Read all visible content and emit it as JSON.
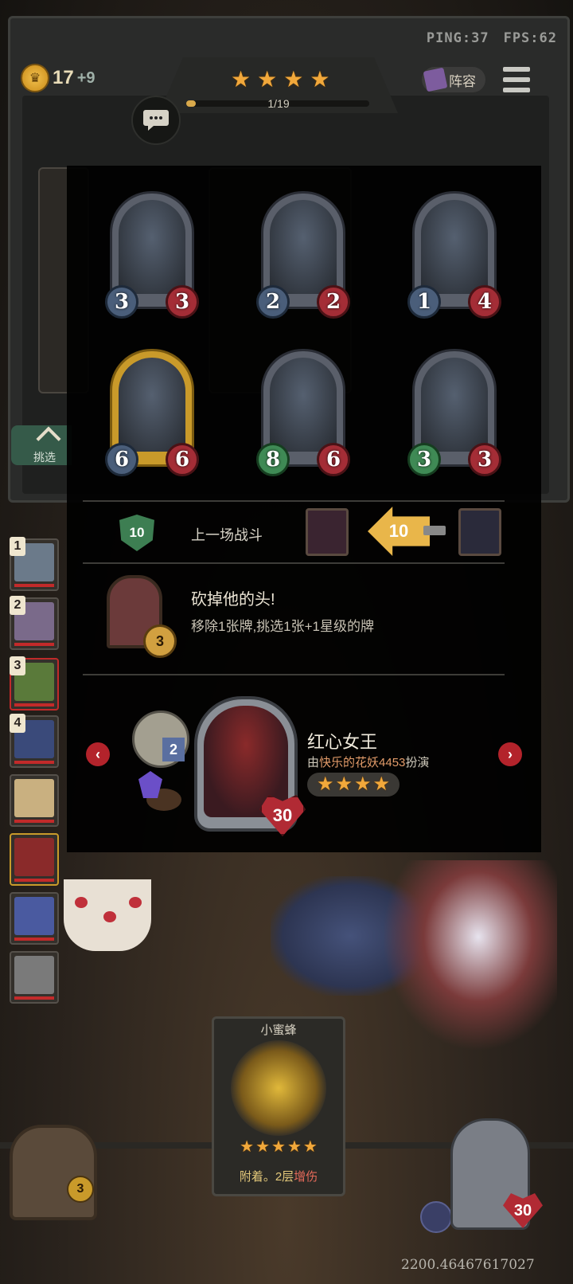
{
  "status": {
    "ping": "PING:37",
    "fps": "FPS:62"
  },
  "gold": {
    "amount": "17",
    "bonus": "+9"
  },
  "tier": {
    "stars": [
      "★",
      "★",
      "★",
      "★"
    ],
    "xp_text": "1/19",
    "xp_fraction": 0.053
  },
  "lineup_button": "阵容",
  "refresh_button": "挑选",
  "shop_cards": [
    {
      "atk": "3",
      "hp": "3",
      "gold": false
    },
    {
      "atk": "2",
      "hp": "2",
      "gold": false
    },
    {
      "atk": "1",
      "hp": "4",
      "gold": false
    },
    {
      "atk": "6",
      "hp": "6",
      "gold": true
    },
    {
      "atk": "8",
      "hp": "6",
      "gold": false,
      "atk_color": "green"
    },
    {
      "atk": "3",
      "hp": "3",
      "gold": false,
      "atk_color": "green"
    }
  ],
  "last_battle": {
    "badge": "10",
    "label": "上一场战斗",
    "damage": "10"
  },
  "event": {
    "title": "砍掉他的头!",
    "description": "移除1张牌,挑选1张+1星级的牌",
    "level": "3"
  },
  "hero": {
    "name": "红心女王",
    "player_prefix": "由",
    "player_name": "快乐的花妖4453",
    "player_suffix": "扮演",
    "stars": [
      "★",
      "★",
      "★",
      "★"
    ],
    "hp": "30",
    "power_count": "2"
  },
  "roster": [
    "1",
    "2",
    "3",
    "4",
    "",
    "",
    "",
    ""
  ],
  "bottom_card": {
    "name": "小蜜蜂",
    "stars": [
      "★",
      "★",
      "★",
      "★",
      "★"
    ],
    "desc_prefix": "附着。2层",
    "desc_keyword": "增伤"
  },
  "chest_level": "3",
  "player_hp": "30",
  "coordinate": "2200.46467617027"
}
